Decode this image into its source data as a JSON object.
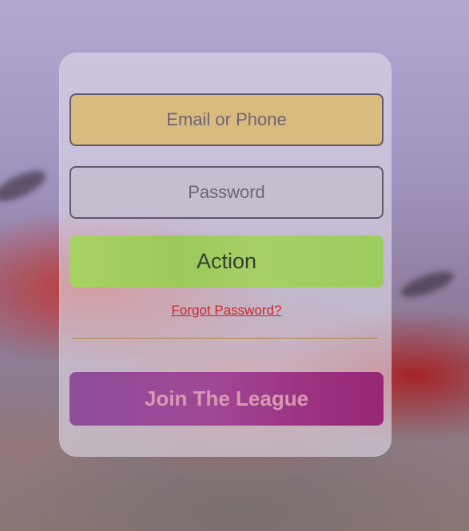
{
  "form": {
    "email_placeholder": "Email or Phone",
    "password_placeholder": "Password",
    "action_label": "Action",
    "forgot_label": "Forgot Password?",
    "join_label": "Join The League"
  },
  "colors": {
    "email_field": "#dabA7a",
    "action_button": "#a4cf62",
    "forgot_link": "#c5282a",
    "join_button": "#9a3a88",
    "join_text": "#d79ab2"
  }
}
